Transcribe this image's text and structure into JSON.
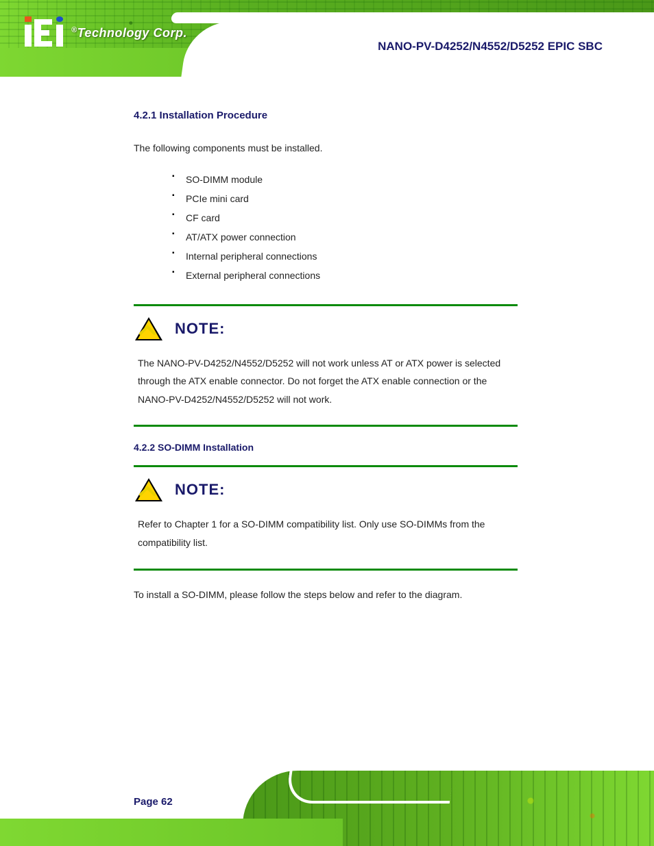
{
  "header": {
    "brand_prefix": "®",
    "brand": "Technology Corp.",
    "doc_title": "NANO-PV-D4252/N4552/D5252 EPIC SBC"
  },
  "section": {
    "heading": "4.2.1 Installation Procedure",
    "intro": "The following components must be installed.",
    "bullets": [
      "SO-DIMM module",
      "PCIe mini card",
      "CF card",
      "AT/ATX power connection",
      "Internal peripheral connections",
      "External peripheral connections"
    ]
  },
  "callout1": {
    "label": "NOTE:",
    "body": "The NANO-PV-D4252/N4552/D5252 will not work unless AT or ATX power is selected through the ATX enable connector. Do not forget the ATX enable connection or the NANO-PV-D4252/N4552/D5252 will not work."
  },
  "subsection": {
    "heading": "4.2.2 SO-DIMM Installation"
  },
  "callout2": {
    "label": "NOTE:",
    "body": "Refer to Chapter 1 for a SO-DIMM compatibility list. Only use SO-DIMMs from the compatibility list."
  },
  "closing": "To install a SO-DIMM, please follow the steps below and refer to the diagram.",
  "footer": {
    "page": "Page 62"
  }
}
